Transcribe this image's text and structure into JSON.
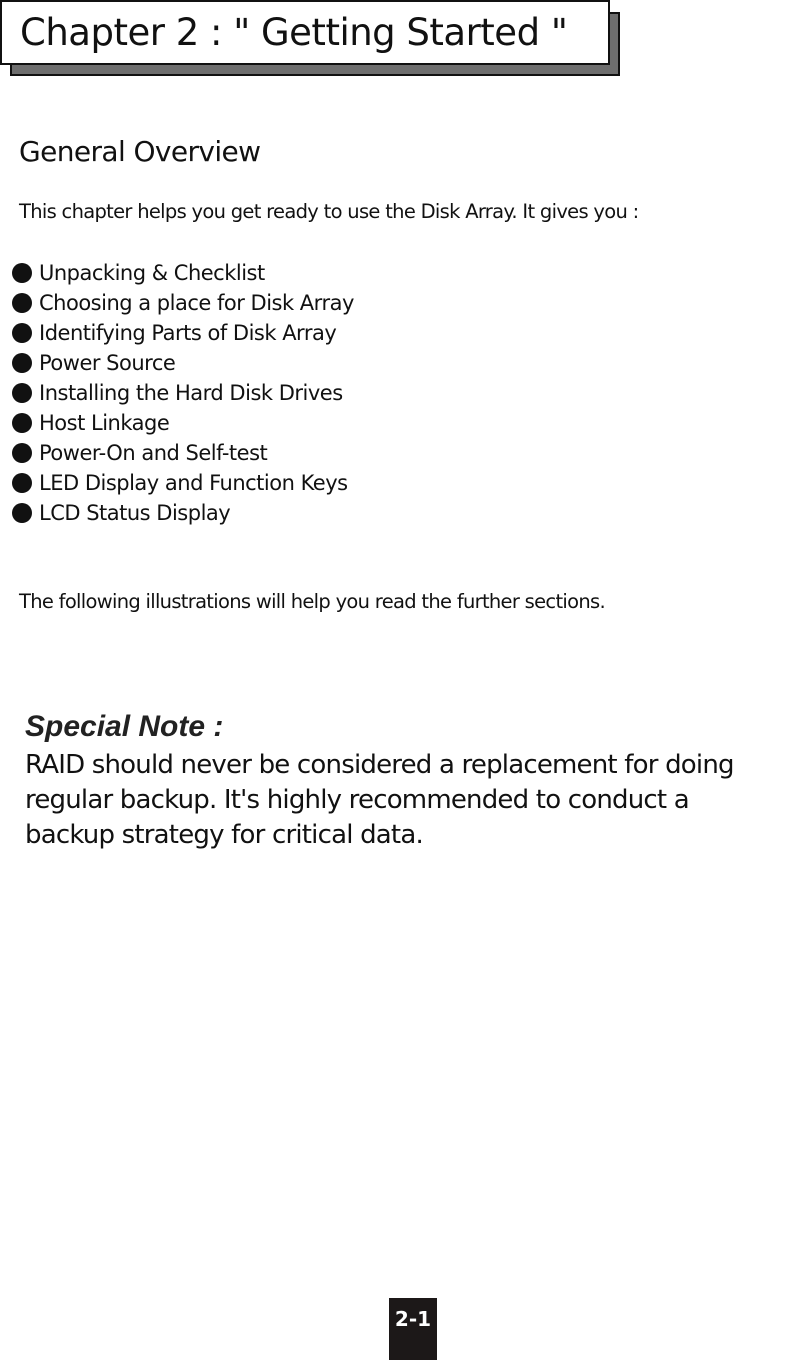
{
  "chapter": {
    "title": "Chapter 2 : \" Getting Started \""
  },
  "overview": {
    "heading": "General Overview",
    "intro": "This chapter helps you get ready to use the Disk Array. It gives you :",
    "topics": [
      "Unpacking & Checklist",
      "Choosing a place for Disk Array",
      "Identifying Parts of Disk Array",
      "Power Source",
      "Installing the Hard Disk Drives",
      "Host Linkage",
      "Power-On and Self-test",
      "LED Display and Function Keys",
      "LCD Status Display"
    ],
    "following": "The following illustrations will help you read the further sections."
  },
  "special_note": {
    "title": "Special Note :",
    "lines": [
      "RAID should never be considered a replacement for doing",
      "regular backup. It's highly recommended to conduct a",
      "backup strategy for critical data."
    ]
  },
  "footer": {
    "page_number": "2-1"
  }
}
